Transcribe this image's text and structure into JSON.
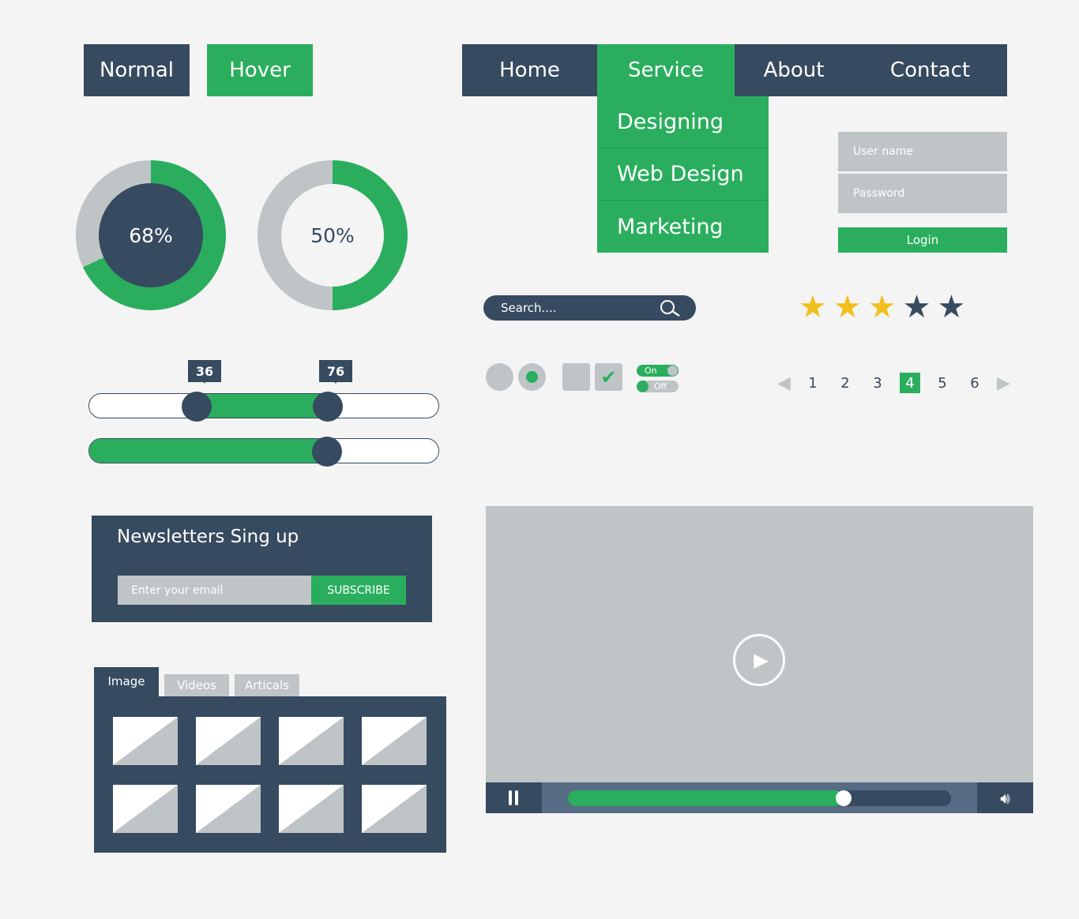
{
  "buttons": {
    "normal": "Normal",
    "hover": "Hover"
  },
  "nav": {
    "items": [
      "Home",
      "Service",
      "About",
      "Contact"
    ],
    "active": "Service",
    "dropdown": [
      "Designing",
      "Web Design",
      "Marketing"
    ]
  },
  "login": {
    "username_placeholder": "User name",
    "password_placeholder": "Password",
    "login_label": "Login"
  },
  "donuts": [
    {
      "label": "68%",
      "value": 68
    },
    {
      "label": "50%",
      "value": 50
    }
  ],
  "search": {
    "placeholder": "Search....",
    "icon": "search-icon"
  },
  "rating": {
    "value": 3,
    "max": 5
  },
  "sliders": {
    "range_low_label": "36",
    "range_high_label": "76",
    "single_value_percent": 68
  },
  "toggles": {
    "on": "On",
    "off": "Off"
  },
  "pagination": {
    "pages": [
      "1",
      "2",
      "3",
      "4",
      "5",
      "6"
    ],
    "active": "4"
  },
  "newsletter": {
    "title": "Newsletters Sing up",
    "placeholder": "Enter your email",
    "button": "SUBSCRIBE"
  },
  "tabs": {
    "items": [
      "Image",
      "Videos",
      "Articals"
    ],
    "active": "Image"
  },
  "video": {
    "progress_percent": 72
  },
  "colors": {
    "dark": "#364a60",
    "green": "#2aae5e",
    "gray": "#bfc4c7",
    "star": "#f2c01c"
  }
}
